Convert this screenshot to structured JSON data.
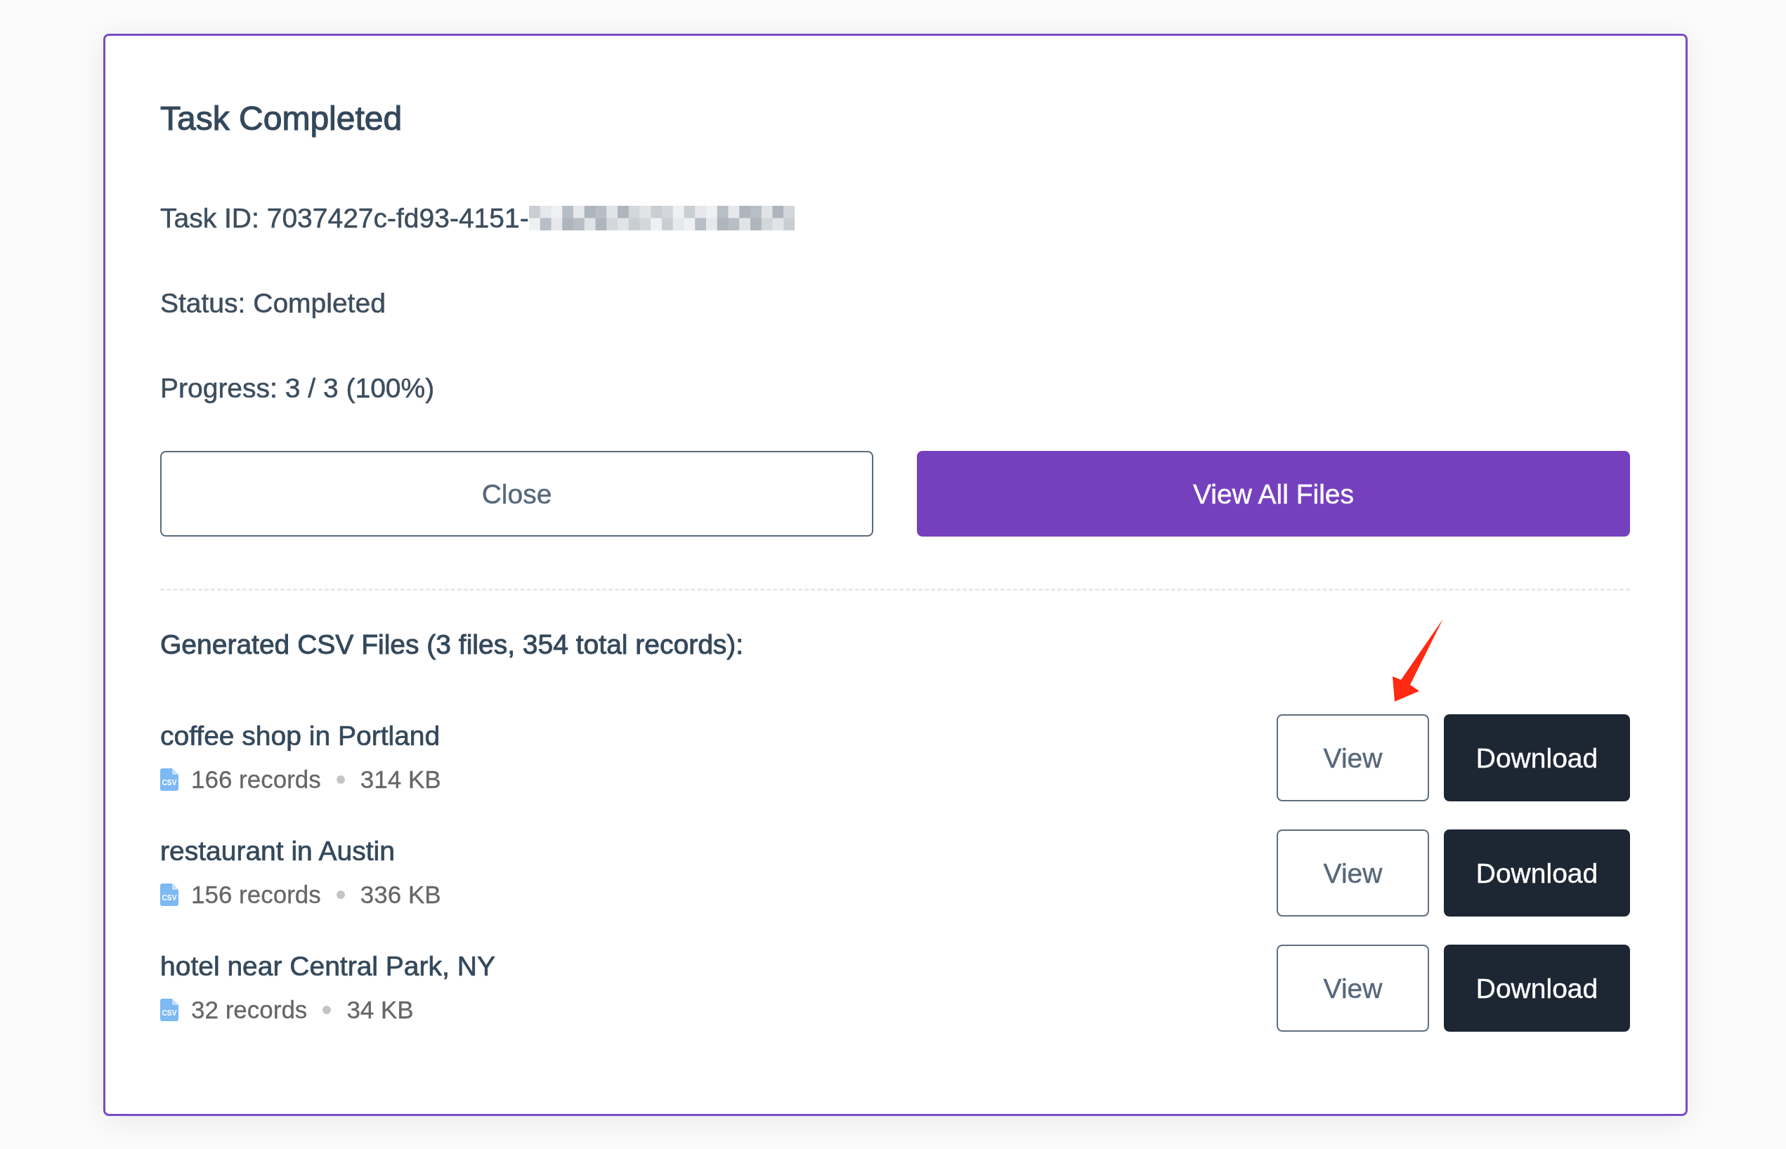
{
  "dialog": {
    "title": "Task Completed"
  },
  "details": [
    {
      "text": "Task ID: 7037427c-fd93-4151-",
      "redacted": true
    },
    {
      "text": "Status: Completed",
      "redacted": false
    },
    {
      "text": "Progress: 3 / 3 (100%)",
      "redacted": false
    }
  ],
  "actions": [
    {
      "label": "Close",
      "kind": "secondary"
    },
    {
      "label": "View All Files",
      "kind": "primary"
    }
  ],
  "files_heading": "Generated CSV Files (3 files, 354 total records):",
  "files": [
    {
      "name": "coffee shop in Portland",
      "file_type": "CSV",
      "records": "166 records",
      "size": "314 KB",
      "arrow_marker": true,
      "buttons": [
        {
          "label": "View",
          "kind": "outline"
        },
        {
          "label": "Download",
          "kind": "dark"
        }
      ]
    },
    {
      "name": "restaurant in Austin",
      "file_type": "CSV",
      "records": "156 records",
      "size": "336 KB",
      "arrow_marker": false,
      "buttons": [
        {
          "label": "View",
          "kind": "outline"
        },
        {
          "label": "Download",
          "kind": "dark"
        }
      ]
    },
    {
      "name": "hotel near Central Park, NY",
      "file_type": "CSV",
      "records": "32 records",
      "size": "34 KB",
      "arrow_marker": false,
      "buttons": [
        {
          "label": "View",
          "kind": "outline"
        },
        {
          "label": "Download",
          "kind": "dark"
        }
      ]
    }
  ]
}
